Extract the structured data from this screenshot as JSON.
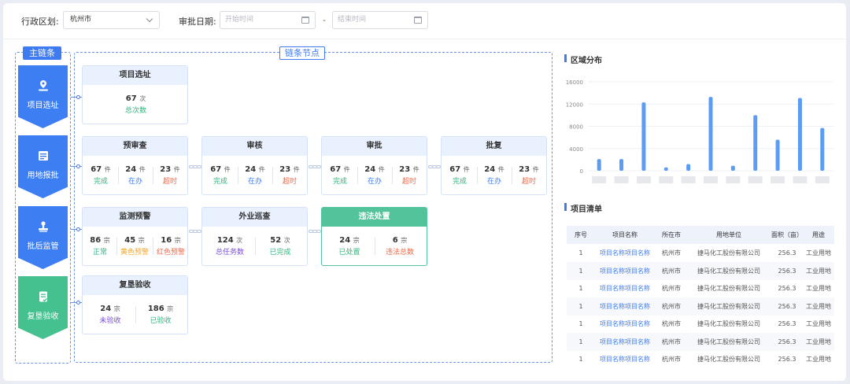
{
  "filter": {
    "region_label": "行政区划:",
    "region_value": "杭州市",
    "date_label": "审批日期:",
    "start_placeholder": "开始时间",
    "end_placeholder": "结束时间",
    "separator": "-"
  },
  "main_chain": {
    "title": "主链条",
    "items": [
      {
        "label": "项目选址",
        "icon": "location-icon",
        "color": "#3d7ff2"
      },
      {
        "label": "用地报批",
        "icon": "document-icon",
        "color": "#3d7ff2"
      },
      {
        "label": "批后监管",
        "icon": "stamp-icon",
        "color": "#3d7ff2"
      },
      {
        "label": "复垦验收",
        "icon": "checklist-icon",
        "color": "#45c08f"
      }
    ]
  },
  "nodes": {
    "title": "链条节点",
    "site": {
      "title": "项目选址",
      "stats": [
        {
          "num": "67",
          "unit": "次",
          "cap": "总次数",
          "color": "#2fb67c"
        }
      ]
    },
    "pre_review": {
      "title": "预审查",
      "stats": [
        {
          "num": "67",
          "unit": "件",
          "cap": "完成",
          "color": "#2fb67c"
        },
        {
          "num": "24",
          "unit": "件",
          "cap": "在办",
          "color": "#3f7bf0"
        },
        {
          "num": "23",
          "unit": "件",
          "cap": "超时",
          "color": "#f06a48"
        }
      ]
    },
    "review": {
      "title": "审核",
      "stats": [
        {
          "num": "67",
          "unit": "件",
          "cap": "完成",
          "color": "#2fb67c"
        },
        {
          "num": "24",
          "unit": "件",
          "cap": "在办",
          "color": "#3f7bf0"
        },
        {
          "num": "23",
          "unit": "件",
          "cap": "超时",
          "color": "#f06a48"
        }
      ]
    },
    "approve": {
      "title": "审批",
      "stats": [
        {
          "num": "67",
          "unit": "件",
          "cap": "完成",
          "color": "#2fb67c"
        },
        {
          "num": "24",
          "unit": "件",
          "cap": "在办",
          "color": "#3f7bf0"
        },
        {
          "num": "23",
          "unit": "件",
          "cap": "超时",
          "color": "#f06a48"
        }
      ]
    },
    "reply": {
      "title": "批复",
      "stats": [
        {
          "num": "67",
          "unit": "件",
          "cap": "完成",
          "color": "#2fb67c"
        },
        {
          "num": "24",
          "unit": "件",
          "cap": "在办",
          "color": "#3f7bf0"
        },
        {
          "num": "23",
          "unit": "件",
          "cap": "超时",
          "color": "#f06a48"
        }
      ]
    },
    "monitor": {
      "title": "监测预警",
      "stats": [
        {
          "num": "86",
          "unit": "宗",
          "cap": "正常",
          "color": "#2fb67c"
        },
        {
          "num": "45",
          "unit": "宗",
          "cap": "黄色预警",
          "color": "#f5a623"
        },
        {
          "num": "16",
          "unit": "宗",
          "cap": "红色预警",
          "color": "#f06a48"
        }
      ]
    },
    "field": {
      "title": "外业巡查",
      "stats": [
        {
          "num": "124",
          "unit": "次",
          "cap": "总任务数",
          "color": "#7a4fd6"
        },
        {
          "num": "52",
          "unit": "次",
          "cap": "已完成",
          "color": "#2fb67c"
        }
      ]
    },
    "violation": {
      "title": "违法处置",
      "stats": [
        {
          "num": "24",
          "unit": "宗",
          "cap": "已处置",
          "color": "#2fb67c"
        },
        {
          "num": "6",
          "unit": "宗",
          "cap": "违法总数",
          "color": "#f06a48"
        }
      ]
    },
    "reclaim": {
      "title": "复垦验收",
      "stats": [
        {
          "num": "24",
          "unit": "宗",
          "cap": "未验收",
          "color": "#7a4fd6"
        },
        {
          "num": "186",
          "unit": "宗",
          "cap": "已验收",
          "color": "#2fb67c"
        }
      ]
    }
  },
  "region_section": {
    "title": "区域分布"
  },
  "chart_data": {
    "type": "bar",
    "title": "区域分布",
    "ylim": [
      0,
      16000
    ],
    "yticks": [
      "0",
      "4000",
      "8000",
      "12000",
      "16000"
    ],
    "categories": [
      "",
      "",
      "",
      "",
      "",
      "",
      "",
      "",
      "",
      "",
      "",
      ""
    ],
    "values": [
      2100,
      2100,
      12300,
      600,
      1200,
      13300,
      900,
      10000,
      5600,
      13100,
      7700
    ],
    "bar_color": "#5b9cf5",
    "grid": true
  },
  "table_section": {
    "title": "项目清单"
  },
  "table": {
    "headers": [
      "序号",
      "项目名称",
      "所在市",
      "用地单位",
      "面积（亩）",
      "用途"
    ],
    "rows": [
      [
        "1",
        "项目名称项目名称",
        "杭州市",
        "捷马化工股份有限公司",
        "256.3",
        "工业用地"
      ],
      [
        "1",
        "项目名称项目名称",
        "杭州市",
        "捷马化工股份有限公司",
        "256.3",
        "工业用地"
      ],
      [
        "1",
        "项目名称项目名称",
        "杭州市",
        "捷马化工股份有限公司",
        "256.3",
        "工业用地"
      ],
      [
        "1",
        "项目名称项目名称",
        "杭州市",
        "捷马化工股份有限公司",
        "256.3",
        "工业用地"
      ],
      [
        "1",
        "项目名称项目名称",
        "杭州市",
        "捷马化工股份有限公司",
        "256.3",
        "工业用地"
      ],
      [
        "1",
        "项目名称项目名称",
        "杭州市",
        "捷马化工股份有限公司",
        "256.3",
        "工业用地"
      ],
      [
        "1",
        "项目名称项目名称",
        "杭州市",
        "捷马化工股份有限公司",
        "256.3",
        "工业用地"
      ]
    ]
  }
}
